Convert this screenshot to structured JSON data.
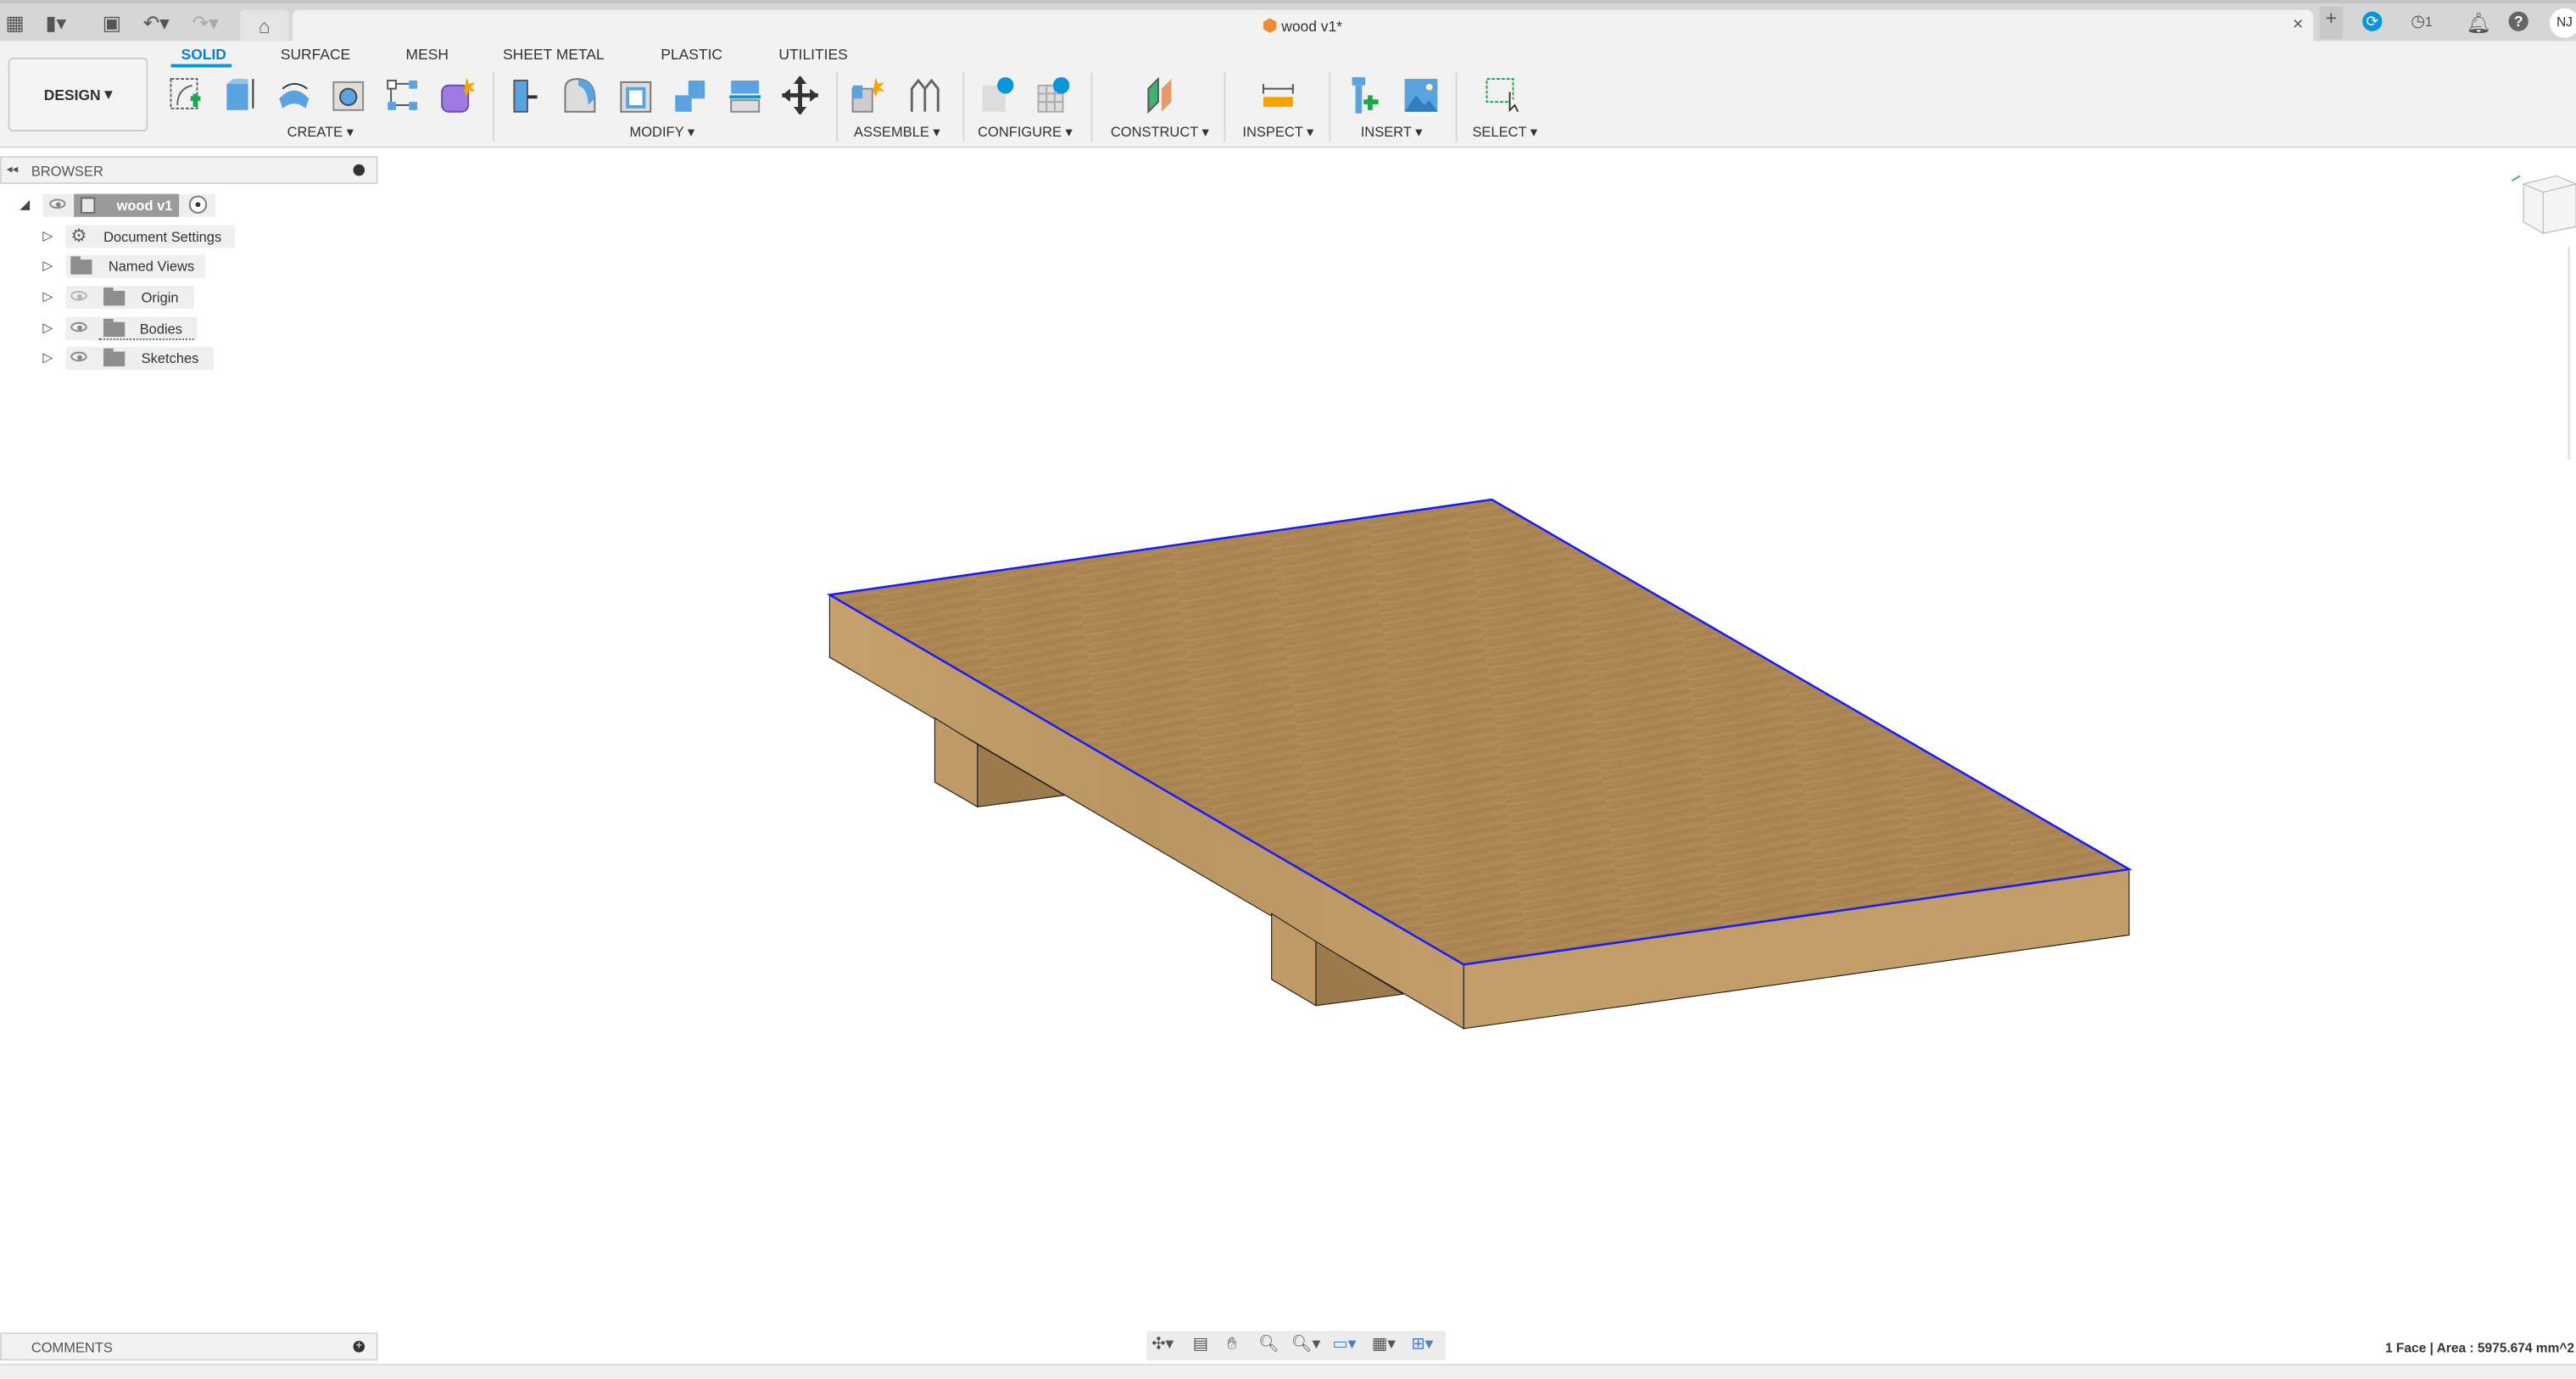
{
  "window": {
    "title": "wood v1*",
    "user_initials": "NJ",
    "jobs_count": "1"
  },
  "toolbar": {
    "workspace": "DESIGN",
    "tabs": [
      "SOLID",
      "SURFACE",
      "MESH",
      "SHEET METAL",
      "PLASTIC",
      "UTILITIES"
    ],
    "active_tab": "SOLID",
    "groups": [
      "CREATE ▾",
      "MODIFY ▾",
      "ASSEMBLE ▾",
      "CONFIGURE ▾",
      "CONSTRUCT ▾",
      "INSPECT ▾",
      "INSERT ▾",
      "SELECT ▾"
    ]
  },
  "browser": {
    "title": "BROWSER",
    "root": "wood v1",
    "items": [
      "Document Settings",
      "Named Views",
      "Origin",
      "Bodies",
      "Sketches"
    ]
  },
  "comments": {
    "title": "COMMENTS"
  },
  "status": {
    "text": "1 Face | Area : 5975.674 mm^2"
  },
  "colors": {
    "accent": "#0696d7",
    "selection_edge": "#1a1aff",
    "wood_top": "#b08b5a",
    "wood_side": "#c29c68"
  }
}
